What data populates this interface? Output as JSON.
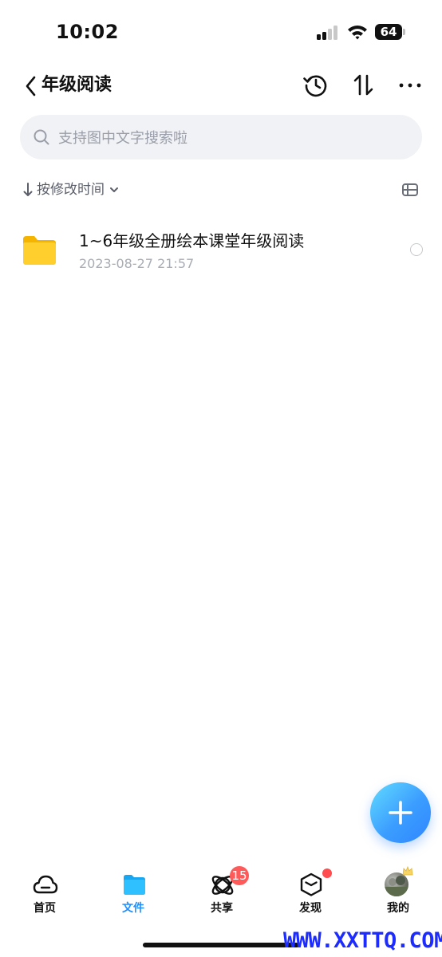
{
  "status_bar": {
    "time": "10:02",
    "battery": "64"
  },
  "header": {
    "title": "年级阅读"
  },
  "search": {
    "placeholder": "支持图中文字搜索啦"
  },
  "sort": {
    "label": "按修改时间"
  },
  "files": [
    {
      "name": "1~6年级全册绘本课堂年级阅读",
      "date": "2023-08-27 21:57",
      "icon": "folder-icon"
    }
  ],
  "tabs": [
    {
      "label": "首页",
      "icon": "cloud-icon",
      "active": false
    },
    {
      "label": "文件",
      "icon": "folder-icon",
      "active": true
    },
    {
      "label": "共享",
      "icon": "orbit-icon",
      "active": false,
      "badge": "15"
    },
    {
      "label": "发现",
      "icon": "cube-icon",
      "active": false,
      "dot": true
    },
    {
      "label": "我的",
      "icon": "avatar",
      "active": false
    }
  ],
  "watermark": "WWW.XXTTQ.COM",
  "colors": {
    "accent": "#1d8fff",
    "badge": "#ff5a5a",
    "folder": "#ffc61a"
  }
}
